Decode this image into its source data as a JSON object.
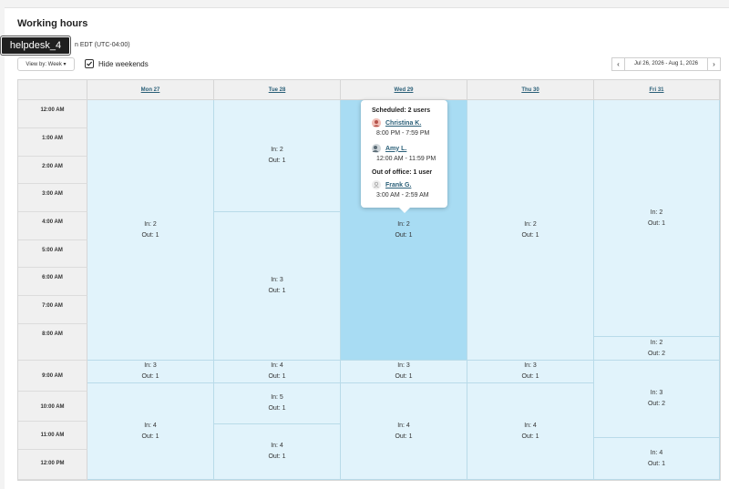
{
  "header": {
    "title": "Working hours",
    "timezone_fragment": "n EDT (UTC-04:00)",
    "badge": "helpdesk_4"
  },
  "toolbar": {
    "view_by": "View by: Week ▾",
    "hide_weekends_label": "Hide weekends",
    "hide_weekends_checked": true,
    "prev": "‹",
    "next": "›",
    "date_range": "Jul 26, 2026 - Aug 1, 2026"
  },
  "calendar": {
    "days": [
      "Mon 27",
      "Tue 28",
      "Wed 29",
      "Thu 30",
      "Fri 31"
    ],
    "times": [
      "12:00 AM",
      "1:00 AM",
      "2:00 AM",
      "3:00 AM",
      "4:00 AM",
      "5:00 AM",
      "6:00 AM",
      "7:00 AM",
      "8:00 AM",
      "9:00 AM",
      "10:00 AM",
      "11:00 AM",
      "12:00 PM"
    ],
    "blocks": {
      "mon_1": {
        "in": "In: 2",
        "out": "Out: 1"
      },
      "mon_2": {
        "in": "In: 3",
        "out": "Out: 1"
      },
      "mon_3": {
        "in": "In: 4",
        "out": "Out: 1"
      },
      "tue_1": {
        "in": "In: 2",
        "out": "Out: 1"
      },
      "tue_2": {
        "in": "In: 3",
        "out": "Out: 1"
      },
      "tue_3": {
        "in": "In: 4",
        "out": "Out: 1"
      },
      "tue_4": {
        "in": "In: 5",
        "out": "Out: 1"
      },
      "tue_5": {
        "in": "In: 4",
        "out": "Out: 1"
      },
      "wed_1": {
        "in": "In: 2",
        "out": "Out: 1"
      },
      "wed_2": {
        "in": "In: 3",
        "out": "Out: 1"
      },
      "wed_3": {
        "in": "In: 4",
        "out": "Out: 1"
      },
      "thu_1": {
        "in": "In: 2",
        "out": "Out: 1"
      },
      "thu_2": {
        "in": "In: 3",
        "out": "Out: 1"
      },
      "thu_3": {
        "in": "In: 4",
        "out": "Out: 1"
      },
      "fri_1": {
        "in": "In: 2",
        "out": "Out: 1"
      },
      "fri_2": {
        "in": "In: 2",
        "out": "Out: 2"
      },
      "fri_3": {
        "in": "In: 3",
        "out": "Out: 2"
      },
      "fri_4": {
        "in": "In: 4",
        "out": "Out: 1"
      }
    }
  },
  "tooltip": {
    "scheduled_heading": "Scheduled: 2 users",
    "user1_name": "Christina K.",
    "user1_time": "8:00 PM - 7:59 PM",
    "user2_name": "Amy L.",
    "user2_time": "12:00 AM - 11:59 PM",
    "out_heading": "Out of office: 1 user",
    "user3_name": "Frank G.",
    "user3_time": "3:00 AM - 2:59 AM"
  },
  "colors": {
    "accent_link": "#2a5f78",
    "block_bg": "#e1f3fb",
    "block_selected_bg": "#a8dcf3"
  }
}
